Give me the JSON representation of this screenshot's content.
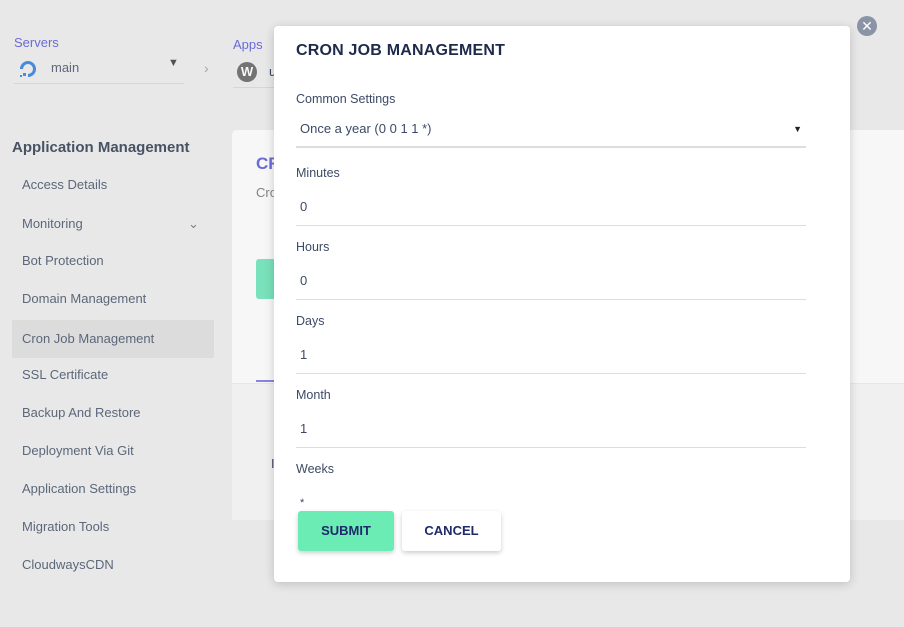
{
  "header": {
    "servers_label": "Servers",
    "server_name": "main",
    "apps_label": "Apps",
    "app_name": "u"
  },
  "sidebar": {
    "title": "Application Management",
    "items": [
      {
        "label": "Access Details"
      },
      {
        "label": "Monitoring"
      },
      {
        "label": "Bot Protection"
      },
      {
        "label": "Domain Management"
      },
      {
        "label": "Cron Job Management",
        "active": true
      },
      {
        "label": "SSL Certificate"
      },
      {
        "label": "Backup And Restore"
      },
      {
        "label": "Deployment Via Git"
      },
      {
        "label": "Application Settings"
      },
      {
        "label": "Migration Tools"
      },
      {
        "label": "CloudwaysCDN"
      }
    ]
  },
  "background_card": {
    "title": "CR",
    "subtitle": "Cro",
    "row_text": "I"
  },
  "modal": {
    "title": "CRON JOB MANAGEMENT",
    "common_settings_label": "Common Settings",
    "common_settings_value": "Once a year (0 0 1 1 *)",
    "fields": [
      {
        "label": "Minutes",
        "value": "0"
      },
      {
        "label": "Hours",
        "value": "0"
      },
      {
        "label": "Days",
        "value": "1"
      },
      {
        "label": "Month",
        "value": "1"
      },
      {
        "label": "Weeks",
        "value": "*"
      }
    ],
    "submit_label": "SUBMIT",
    "cancel_label": "CANCEL"
  },
  "colors": {
    "accent": "#6f6fdc",
    "submit": "#6aecb4",
    "title": "#1e2a4a",
    "close": "#8a94a6"
  }
}
